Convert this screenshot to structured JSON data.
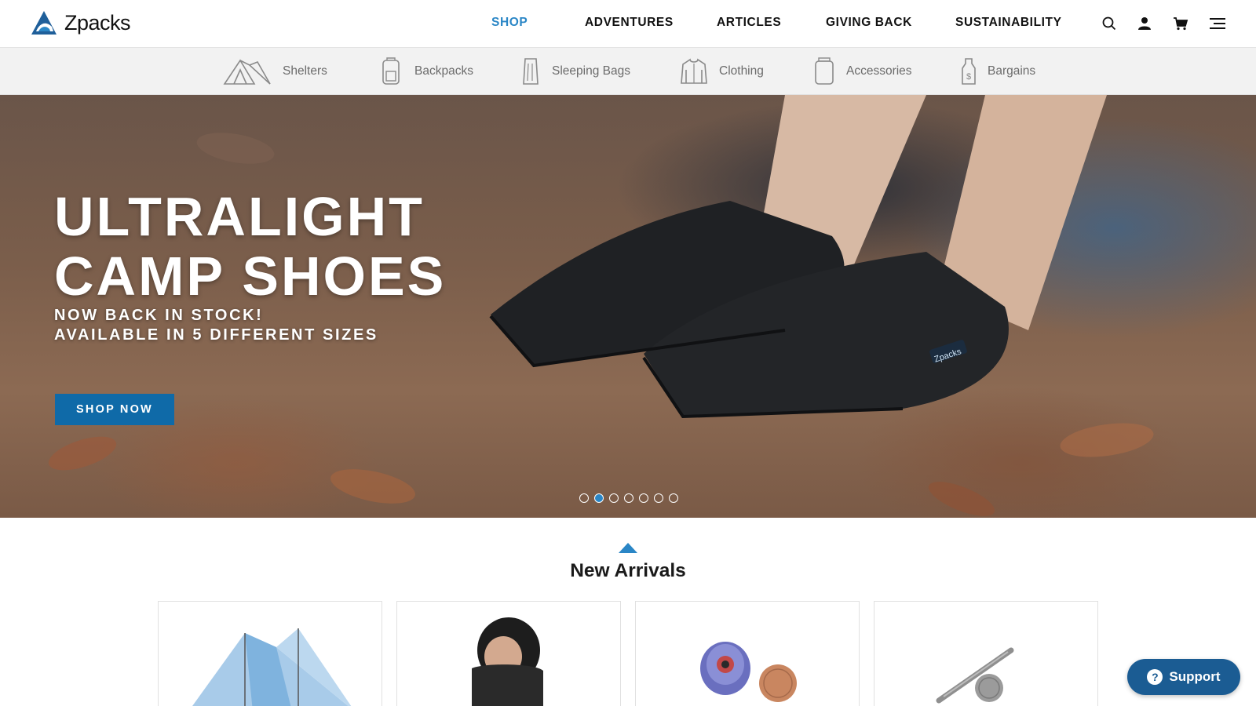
{
  "brand": {
    "name": "Zpacks",
    "accent": "#2a86c6",
    "button_blue": "#0f6aa8",
    "support_blue": "#1b5c93"
  },
  "main_nav": [
    {
      "label": "SHOP",
      "active": true
    },
    {
      "label": "ADVENTURES",
      "active": false
    },
    {
      "label": "ARTICLES",
      "active": false
    },
    {
      "label": "GIVING BACK",
      "active": false
    },
    {
      "label": "SUSTAINABILITY",
      "active": false
    }
  ],
  "utility_icons": [
    "search-icon",
    "account-icon",
    "cart-icon",
    "menu-icon"
  ],
  "categories": [
    {
      "label": "Shelters",
      "icon": "tent-icon"
    },
    {
      "label": "Backpacks",
      "icon": "backpack-icon"
    },
    {
      "label": "Sleeping Bags",
      "icon": "sleeping-bag-icon"
    },
    {
      "label": "Clothing",
      "icon": "jacket-icon"
    },
    {
      "label": "Accessories",
      "icon": "bottle-icon"
    },
    {
      "label": "Bargains",
      "icon": "price-tag-icon"
    }
  ],
  "hero": {
    "title_line1": "ULTRALIGHT",
    "title_line2": "CAMP SHOES",
    "subtitle_line1": "NOW BACK IN STOCK!",
    "subtitle_line2": "AVAILABLE IN 5 DIFFERENT SIZES",
    "cta": "SHOP NOW",
    "slide_count": 7,
    "active_slide": 2,
    "shoe_logo": "Zpacks"
  },
  "new_arrivals": {
    "title": "New Arrivals",
    "products": [
      {
        "image": "blue-tent-image"
      },
      {
        "image": "neck-gaiter-image"
      },
      {
        "image": "bottle-cap-with-penny-image"
      },
      {
        "image": "titanium-pen-with-coin-image"
      }
    ]
  },
  "support": {
    "label": "Support",
    "icon": "help-icon"
  }
}
